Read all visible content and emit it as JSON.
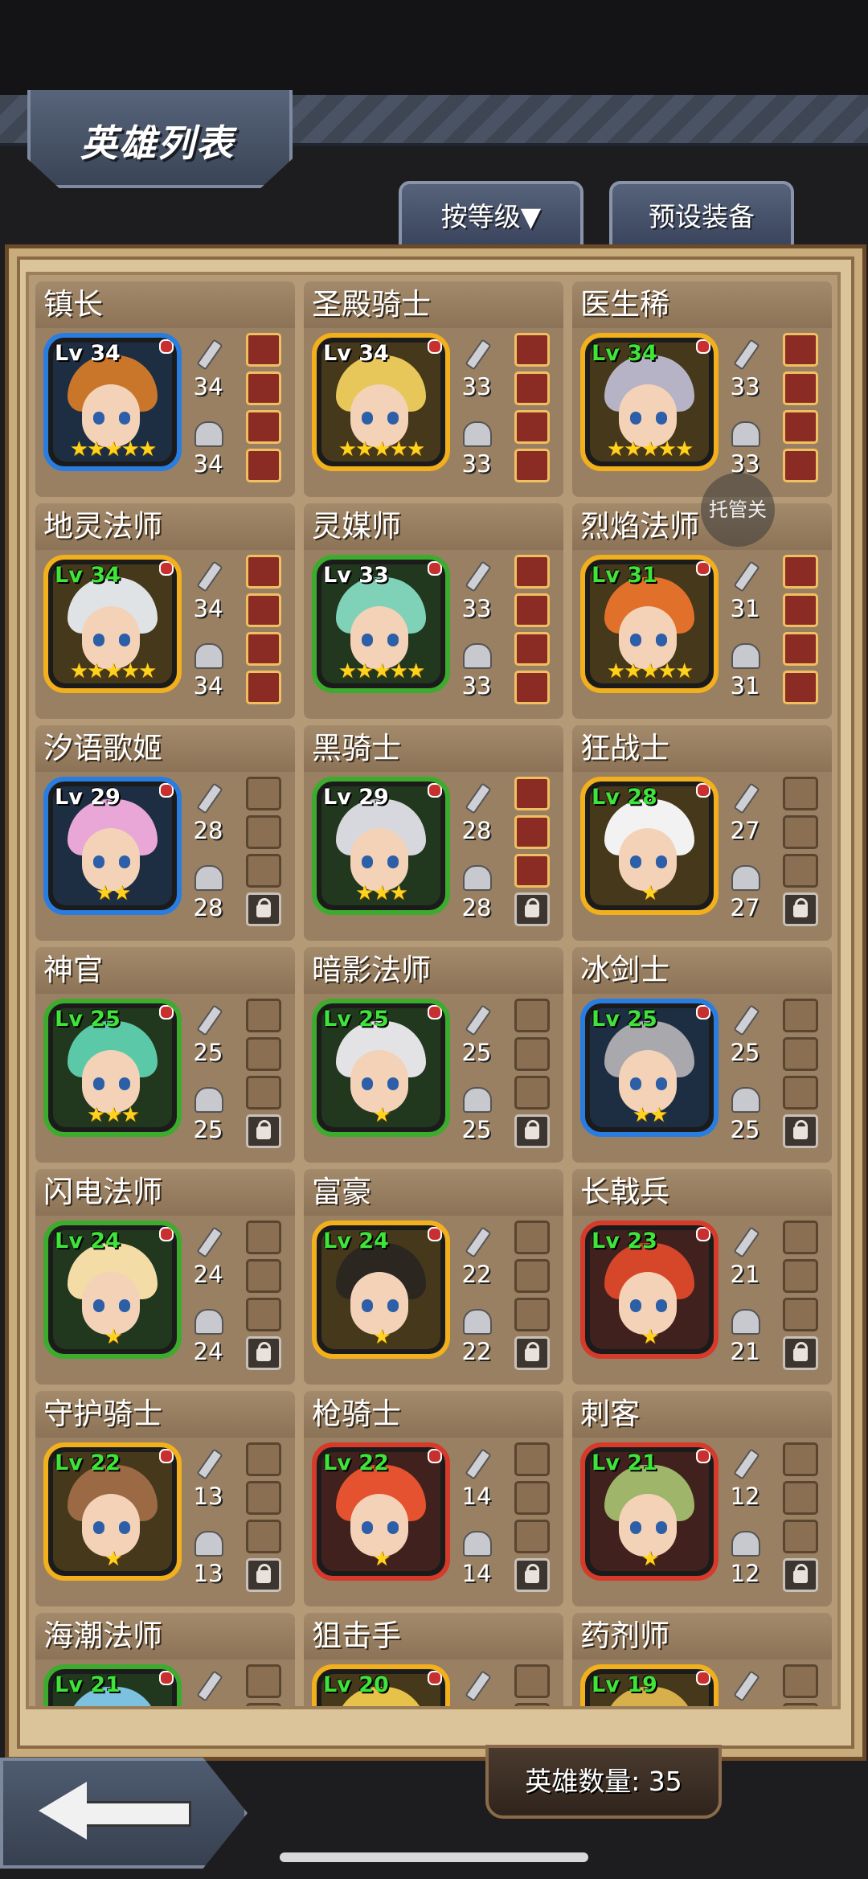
{
  "header": {
    "title": "英雄列表"
  },
  "toolbar": {
    "sort_label": "按等级▼",
    "preset_label": "预设装备"
  },
  "overlay": {
    "label": "托管关"
  },
  "footer": {
    "hero_count": "英雄数量: 35"
  },
  "colors": {
    "blue": "#2a7de0",
    "gold": "#f2b01c",
    "green": "#3dab2e",
    "red": "#d53a2b"
  },
  "heroes": [
    {
      "name": "镇长",
      "lv": "Lv 34",
      "atk": "34",
      "def": "34",
      "stars": "★★★★★",
      "frame": "blue",
      "lvcolor": "white",
      "slots": [
        "filled",
        "filled",
        "filled",
        "filled"
      ]
    },
    {
      "name": "圣殿骑士",
      "lv": "Lv 34",
      "atk": "33",
      "def": "33",
      "stars": "★★★★★",
      "frame": "gold",
      "lvcolor": "white",
      "slots": [
        "filled",
        "filled",
        "filled",
        "filled"
      ]
    },
    {
      "name": "医生稀",
      "lv": "Lv 34",
      "atk": "33",
      "def": "33",
      "stars": "★★★★★",
      "frame": "gold",
      "lvcolor": "green",
      "slots": [
        "filled",
        "filled",
        "filled",
        "filled"
      ]
    },
    {
      "name": "地灵法师",
      "lv": "Lv 34",
      "atk": "34",
      "def": "34",
      "stars": "★★★★★",
      "frame": "gold",
      "lvcolor": "green",
      "slots": [
        "filled",
        "filled",
        "filled",
        "filled"
      ]
    },
    {
      "name": "灵媒师",
      "lv": "Lv 33",
      "atk": "33",
      "def": "33",
      "stars": "★★★★★",
      "frame": "green",
      "lvcolor": "white",
      "slots": [
        "filled",
        "filled",
        "filled",
        "filled"
      ]
    },
    {
      "name": "烈焰法师",
      "lv": "Lv 31",
      "atk": "31",
      "def": "31",
      "stars": "★★★★★",
      "frame": "gold",
      "lvcolor": "green",
      "slots": [
        "filled",
        "filled",
        "filled",
        "filled"
      ]
    },
    {
      "name": "汐语歌姬",
      "lv": "Lv 29",
      "atk": "28",
      "def": "28",
      "stars": "★★",
      "frame": "blue",
      "lvcolor": "white",
      "slots": [
        "empty",
        "empty",
        "empty",
        "lock"
      ]
    },
    {
      "name": "黑骑士",
      "lv": "Lv 29",
      "atk": "28",
      "def": "28",
      "stars": "★★★",
      "frame": "green",
      "lvcolor": "white",
      "slots": [
        "filled",
        "filled",
        "filled",
        "lock"
      ]
    },
    {
      "name": "狂战士",
      "lv": "Lv 28",
      "atk": "27",
      "def": "27",
      "stars": "★",
      "frame": "gold",
      "lvcolor": "green",
      "slots": [
        "empty",
        "empty",
        "empty",
        "lock"
      ]
    },
    {
      "name": "神官",
      "lv": "Lv 25",
      "atk": "25",
      "def": "25",
      "stars": "★★★",
      "frame": "green",
      "lvcolor": "green",
      "slots": [
        "empty",
        "empty",
        "empty",
        "lock"
      ]
    },
    {
      "name": "暗影法师",
      "lv": "Lv 25",
      "atk": "25",
      "def": "25",
      "stars": "★",
      "frame": "green",
      "lvcolor": "green",
      "slots": [
        "empty",
        "empty",
        "empty",
        "lock"
      ]
    },
    {
      "name": "冰剑士",
      "lv": "Lv 25",
      "atk": "25",
      "def": "25",
      "stars": "★★",
      "frame": "blue",
      "lvcolor": "green",
      "slots": [
        "empty",
        "empty",
        "empty",
        "lock"
      ]
    },
    {
      "name": "闪电法师",
      "lv": "Lv 24",
      "atk": "24",
      "def": "24",
      "stars": "★",
      "frame": "green",
      "lvcolor": "green",
      "slots": [
        "empty",
        "empty",
        "empty",
        "lock"
      ]
    },
    {
      "name": "富豪",
      "lv": "Lv 24",
      "atk": "22",
      "def": "22",
      "stars": "★",
      "frame": "gold",
      "lvcolor": "green",
      "slots": [
        "empty",
        "empty",
        "empty",
        "lock"
      ]
    },
    {
      "name": "长戟兵",
      "lv": "Lv 23",
      "atk": "21",
      "def": "21",
      "stars": "★",
      "frame": "red",
      "lvcolor": "green",
      "slots": [
        "empty",
        "empty",
        "empty",
        "lock"
      ]
    },
    {
      "name": "守护骑士",
      "lv": "Lv 22",
      "atk": "13",
      "def": "13",
      "stars": "★",
      "frame": "gold",
      "lvcolor": "green",
      "slots": [
        "empty",
        "empty",
        "empty",
        "lock"
      ]
    },
    {
      "name": "枪骑士",
      "lv": "Lv 22",
      "atk": "14",
      "def": "14",
      "stars": "★",
      "frame": "red",
      "lvcolor": "green",
      "slots": [
        "empty",
        "empty",
        "empty",
        "lock"
      ]
    },
    {
      "name": "刺客",
      "lv": "Lv 21",
      "atk": "12",
      "def": "12",
      "stars": "★",
      "frame": "red",
      "lvcolor": "green",
      "slots": [
        "empty",
        "empty",
        "empty",
        "lock"
      ]
    },
    {
      "name": "海潮法师",
      "lv": "Lv 21",
      "atk": "",
      "def": "",
      "stars": "",
      "frame": "green",
      "lvcolor": "green",
      "slots": [
        "empty",
        "empty",
        "empty",
        "lock"
      ]
    },
    {
      "name": "狙击手",
      "lv": "Lv 20",
      "atk": "",
      "def": "",
      "stars": "",
      "frame": "gold",
      "lvcolor": "green",
      "slots": [
        "empty",
        "empty",
        "empty",
        "lock"
      ]
    },
    {
      "name": "药剂师",
      "lv": "Lv 19",
      "atk": "",
      "def": "",
      "stars": "",
      "frame": "gold",
      "lvcolor": "green",
      "slots": [
        "empty",
        "empty",
        "empty",
        "lock"
      ]
    }
  ]
}
